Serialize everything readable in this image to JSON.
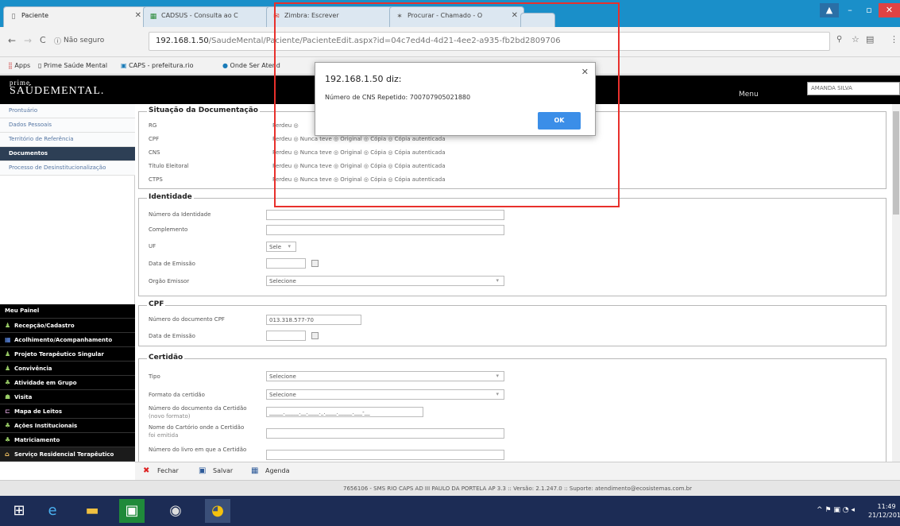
{
  "browser": {
    "tabs": [
      {
        "label": "Paciente",
        "icon": "page-icon"
      },
      {
        "label": "CADSUS - Consulta ao C",
        "icon": "cadsus-icon"
      },
      {
        "label": "Zimbra: Escrever",
        "icon": "zimbra-icon"
      },
      {
        "label": "Procurar - Chamado - O",
        "icon": "ticket-icon"
      }
    ],
    "security_label": "Não seguro",
    "url_host": "192.168.1.50",
    "url_path": "/SaudeMental/Paciente/PacienteEdit.aspx?id=04c7ed4d-4d21-4ee2-a935-fb2bd2809706",
    "bookmarks": [
      "Apps",
      "Prime Saúde Mental",
      "CAPS - prefeitura.rio",
      "Onde Ser Atend"
    ]
  },
  "app": {
    "logo_top": "prime",
    "logo_main": "SAÚDEMENTAL.",
    "menu_label": "Menu",
    "user_name": "AMANDA SILVA"
  },
  "sidebar": {
    "items": [
      "Prontuário",
      "Dados Pessoais",
      "Território de Referência",
      "Documentos",
      "Processo de Desinstitucionalização"
    ],
    "bottom_items": [
      {
        "label": "Meu Painel",
        "icon": ""
      },
      {
        "label": "Recepção/Cadastro",
        "icon": "people-icon"
      },
      {
        "label": "Acolhimento/Acompanhamento",
        "icon": "table-icon"
      },
      {
        "label": "Projeto Terapêutico Singular",
        "icon": "people-icon"
      },
      {
        "label": "Convivência",
        "icon": "people-icon"
      },
      {
        "label": "Atividade em Grupo",
        "icon": "group-icon"
      },
      {
        "label": "Visita",
        "icon": "walk-icon"
      },
      {
        "label": "Mapa de Leitos",
        "icon": "bed-icon"
      },
      {
        "label": "Ações Institucionais",
        "icon": "group-icon"
      },
      {
        "label": "Matriciamento",
        "icon": "group-icon"
      },
      {
        "label": "Serviço Residencial Terapêutico",
        "icon": "house-icon"
      }
    ]
  },
  "situacao": {
    "legend": "Situação da Documentação",
    "rows": [
      {
        "label": "RG",
        "options": "Perdeu ◎"
      },
      {
        "label": "CPF",
        "options": "Perdeu ◎ Nunca teve ◎ Original ◎ Cópia ◎ Cópia autenticada"
      },
      {
        "label": "CNS",
        "options": "Perdeu ◎ Nunca teve ◎ Original ◎ Cópia ◎ Cópia autenticada"
      },
      {
        "label": "Título Eleitoral",
        "options": "Perdeu ◎ Nunca teve ◎ Original ◎ Cópia ◎ Cópia autenticada"
      },
      {
        "label": "CTPS",
        "options": "Perdeu ◎ Nunca teve ◎ Original ◎ Cópia ◎ Cópia autenticada"
      }
    ]
  },
  "identidade": {
    "legend": "Identidade",
    "numero_label": "Número da Identidade",
    "complemento_label": "Complemento",
    "uf_label": "UF",
    "uf_value": "Sele",
    "data_label": "Data de Emissão",
    "orgao_label": "Orgão Emissor",
    "orgao_value": "Selecione"
  },
  "cpf": {
    "legend": "CPF",
    "numero_label": "Número do documento CPF",
    "numero_value": "013.318.577-70",
    "data_label": "Data de Emissão"
  },
  "certidao": {
    "legend": "Certidão",
    "tipo_label": "Tipo",
    "tipo_value": "Selecione",
    "formato_label": "Formato da certidão",
    "formato_value": "Selecione",
    "numero_label": "Número do documento da Certidão",
    "numero_sub": "(novo formato)",
    "numero_mask": "_____._____.__.____._.____._____.___-__",
    "cartorio_label": "Nome do Cartório onde a Certidão",
    "cartorio_sub": "foi emitida",
    "livro_label": "Número do livro em que a Certidão"
  },
  "toolbar": {
    "close": "Fechar",
    "save": "Salvar",
    "agenda": "Agenda"
  },
  "footer": "7656106 - SMS RIO CAPS AD III PAULO DA PORTELA AP 3.3 :: Versão: 2.1.247.0 :: Suporte: atendimento@ecosistemas.com.br",
  "alert": {
    "title": "192.168.1.50 diz:",
    "message": "Número de CNS Repetido: 700707905021880",
    "ok": "OK"
  },
  "taskbar": {
    "time": "11:49",
    "date": "21/12/2017"
  },
  "colors": {
    "tab_bar": "#1a8fc9",
    "app_header": "#000000",
    "ok_button": "#3b8ee8",
    "annotation": "#e8302c"
  }
}
